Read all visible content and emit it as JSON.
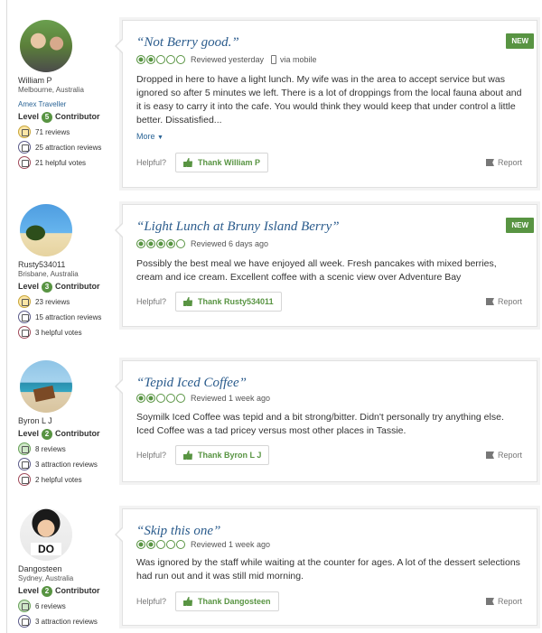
{
  "reviews": [
    {
      "user": {
        "name": "William P",
        "location": "Melbourne, Australia",
        "tag": "Amex Traveller",
        "level_prefix": "Level",
        "level": "5",
        "level_suffix": "Contributor"
      },
      "stats": [
        "71 reviews",
        "25 attraction reviews",
        "21 helpful votes"
      ],
      "title": "“Not Berry good.”",
      "rating": 2,
      "reviewed": "Reviewed yesterday",
      "via": "via mobile",
      "badge": "NEW",
      "text": "Dropped in here to have a light lunch. My wife was in the area to accept service but was ignored so after 5 minutes we left. There is a lot of droppings from the local fauna about and it is easy to carry it into the cafe. You would think they would keep that under control a little better. Dissatisfied...",
      "more": "More",
      "helpful": "Helpful?",
      "thank": "Thank William P",
      "report": "Report"
    },
    {
      "user": {
        "name": "Rusty534011",
        "location": "Brisbane, Australia",
        "tag": "",
        "level_prefix": "Level",
        "level": "3",
        "level_suffix": "Contributor"
      },
      "stats": [
        "23 reviews",
        "15 attraction reviews",
        "3 helpful votes"
      ],
      "title": "“Light Lunch at Bruny Island Berry”",
      "rating": 4,
      "reviewed": "Reviewed 6 days ago",
      "via": "",
      "badge": "NEW",
      "text": "Possibly the best meal we have enjoyed all week. Fresh pancakes with mixed berries, cream and ice cream. Excellent coffee with a scenic view over Adventure Bay",
      "more": "",
      "helpful": "Helpful?",
      "thank": "Thank Rusty534011",
      "report": "Report"
    },
    {
      "user": {
        "name": "Byron L J",
        "location": "",
        "tag": "",
        "level_prefix": "Level",
        "level": "2",
        "level_suffix": "Contributor"
      },
      "stats": [
        "8 reviews",
        "3 attraction reviews",
        "2 helpful votes"
      ],
      "title": "“Tepid Iced Coffee”",
      "rating": 2,
      "reviewed": "Reviewed 1 week ago",
      "via": "",
      "badge": "",
      "text": "Soymilk Iced Coffee was tepid and a bit strong/bitter. Didn't personally try anything else. Iced Coffee was a tad pricey versus most other places in Tassie.",
      "more": "",
      "helpful": "Helpful?",
      "thank": "Thank Byron L J",
      "report": "Report"
    },
    {
      "user": {
        "name": "Dangosteen",
        "location": "Sydney, Australia",
        "tag": "",
        "level_prefix": "Level",
        "level": "2",
        "level_suffix": "Contributor"
      },
      "stats": [
        "6 reviews",
        "3 attraction reviews"
      ],
      "title": "“Skip this one”",
      "rating": 2,
      "reviewed": "Reviewed 1 week ago",
      "via": "",
      "badge": "",
      "text": "Was ignored by the staff while waiting at the counter for ages. A lot of the dessert selections had run out and it was still mid morning.",
      "more": "",
      "helpful": "Helpful?",
      "thank": "Thank Dangosteen",
      "report": "Report"
    }
  ]
}
